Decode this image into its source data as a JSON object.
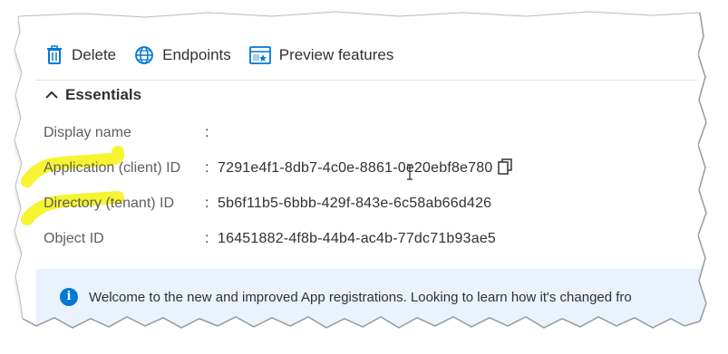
{
  "toolbar": {
    "delete_label": "Delete",
    "endpoints_label": "Endpoints",
    "preview_label": "Preview features"
  },
  "essentials": {
    "title": "Essentials",
    "properties": [
      {
        "label": "Display name",
        "value": ""
      },
      {
        "label": "Application (client) ID",
        "value": "7291e4f1-8db7-4c0e-8861-0e20ebf8e780"
      },
      {
        "label": "Directory (tenant) ID",
        "value": "5b6f11b5-6bbb-429f-843e-6c58ab66d426"
      },
      {
        "label": "Object ID",
        "value": "16451882-4f8b-44b4-ac4b-77dc71b93ae5"
      }
    ],
    "separator": ":"
  },
  "banner": {
    "text": "Welcome to the new and improved App registrations. Looking to learn how it's changed fro"
  },
  "colors": {
    "accent": "#0078d4",
    "highlighter": "#f5f20f",
    "banner_bg": "#eaf2fc"
  }
}
